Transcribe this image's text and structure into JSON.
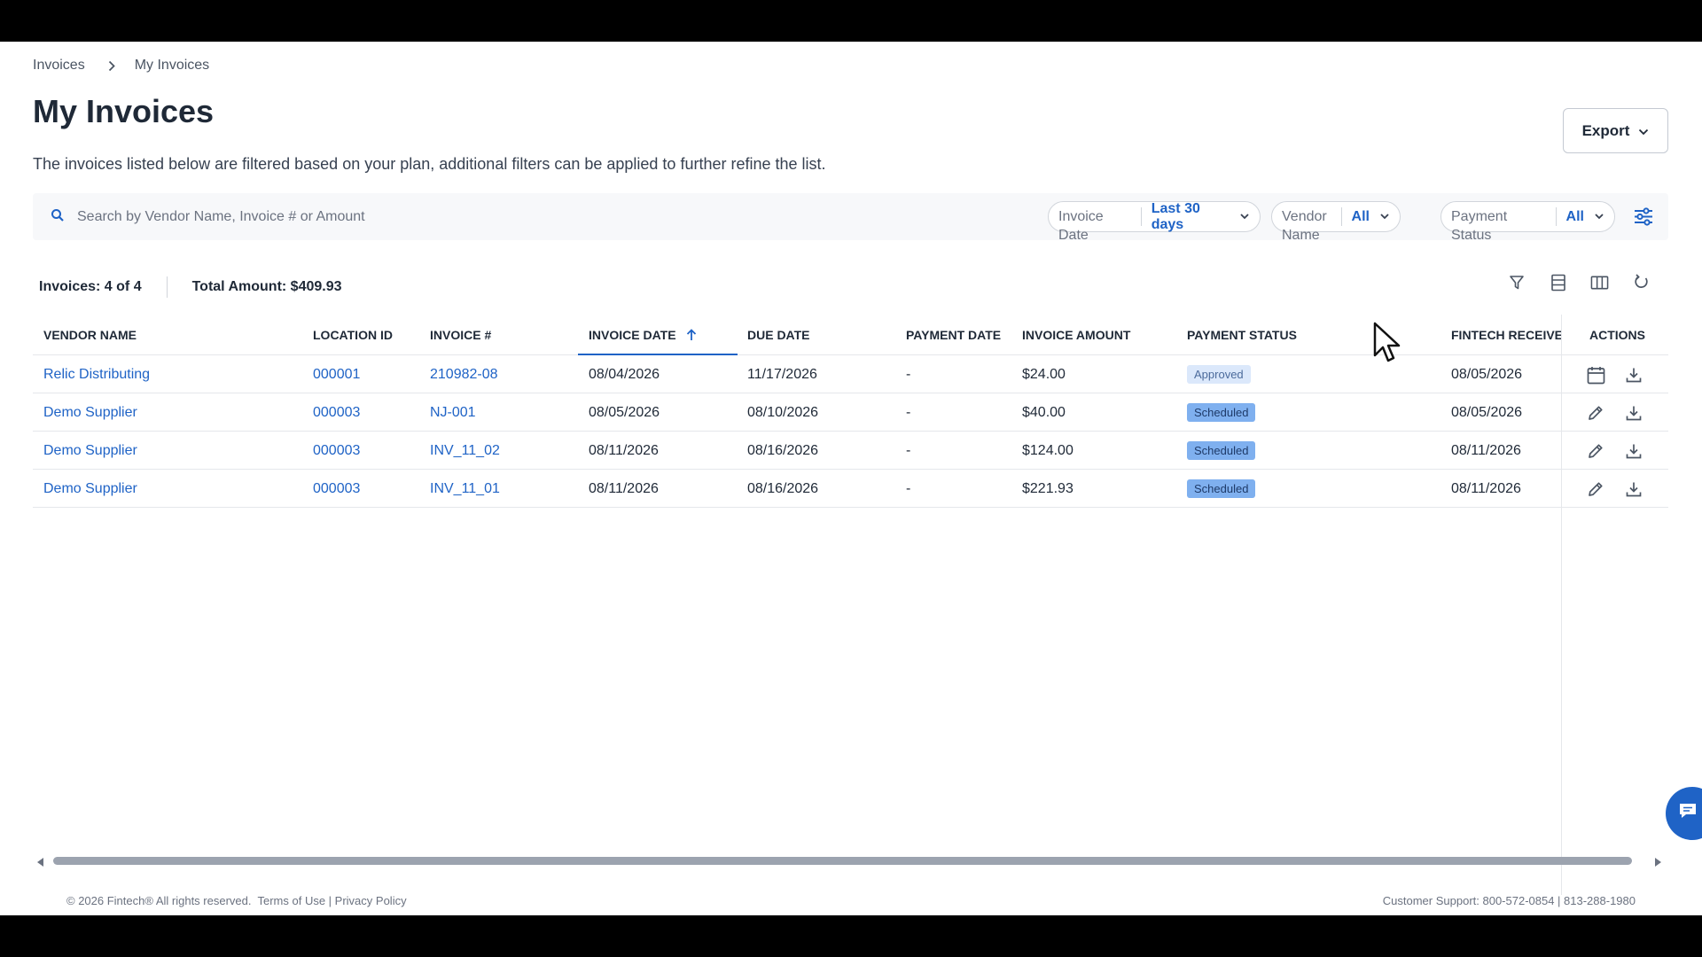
{
  "breadcrumb": {
    "root": "Invoices",
    "current": "My Invoices"
  },
  "page": {
    "title": "My Invoices",
    "subtitle": "The invoices listed below are filtered based on your plan, additional filters can be applied to further refine the list."
  },
  "export": {
    "label": "Export"
  },
  "search": {
    "placeholder": "Search by Vendor Name, Invoice # or Amount"
  },
  "filters": {
    "invoice_date": {
      "label": "Invoice Date",
      "value": "Last 30 days"
    },
    "vendor_name": {
      "label": "Vendor Name",
      "value": "All"
    },
    "payment_status": {
      "label": "Payment Status",
      "value": "All"
    }
  },
  "summary": {
    "invoices": "Invoices: 4 of 4",
    "total": "Total Amount: $409.93"
  },
  "table": {
    "headers": {
      "vendor": "VENDOR NAME",
      "location": "LOCATION ID",
      "invoice": "INVOICE #",
      "invoice_date": "INVOICE DATE",
      "due_date": "DUE DATE",
      "payment_date": "PAYMENT DATE",
      "amount": "INVOICE AMOUNT",
      "status": "PAYMENT STATUS",
      "received": "FINTECH RECEIVED I",
      "actions": "ACTIONS"
    },
    "rows": [
      {
        "vendor": "Relic Distributing",
        "location": "000001",
        "invoice": "210982-08",
        "invoice_date": "08/04/2026",
        "due_date": "11/17/2026",
        "payment_date": "-",
        "amount": "$24.00",
        "status": "Approved",
        "received": "08/05/2026",
        "action_icon": "calendar-icon"
      },
      {
        "vendor": "Demo Supplier",
        "location": "000003",
        "invoice": "NJ-001",
        "invoice_date": "08/05/2026",
        "due_date": "08/10/2026",
        "payment_date": "-",
        "amount": "$40.00",
        "status": "Scheduled",
        "received": "08/05/2026",
        "action_icon": "edit-icon"
      },
      {
        "vendor": "Demo Supplier",
        "location": "000003",
        "invoice": "INV_11_02",
        "invoice_date": "08/11/2026",
        "due_date": "08/16/2026",
        "payment_date": "-",
        "amount": "$124.00",
        "status": "Scheduled",
        "received": "08/11/2026",
        "action_icon": "edit-icon"
      },
      {
        "vendor": "Demo Supplier",
        "location": "000003",
        "invoice": "INV_11_01",
        "invoice_date": "08/11/2026",
        "due_date": "08/16/2026",
        "payment_date": "-",
        "amount": "$221.93",
        "status": "Scheduled",
        "received": "08/11/2026",
        "action_icon": "edit-icon"
      }
    ]
  },
  "footer": {
    "copyright": "© 2026 Fintech® All rights reserved.",
    "terms": "Terms of Use",
    "privacy": "Privacy Policy",
    "support": "Customer Support: 800-572-0854 | 813-288-1980"
  },
  "colors": {
    "accent": "#1f63c6",
    "approved_bg": "#dbe8fb",
    "scheduled_bg": "#7fb0ef"
  }
}
